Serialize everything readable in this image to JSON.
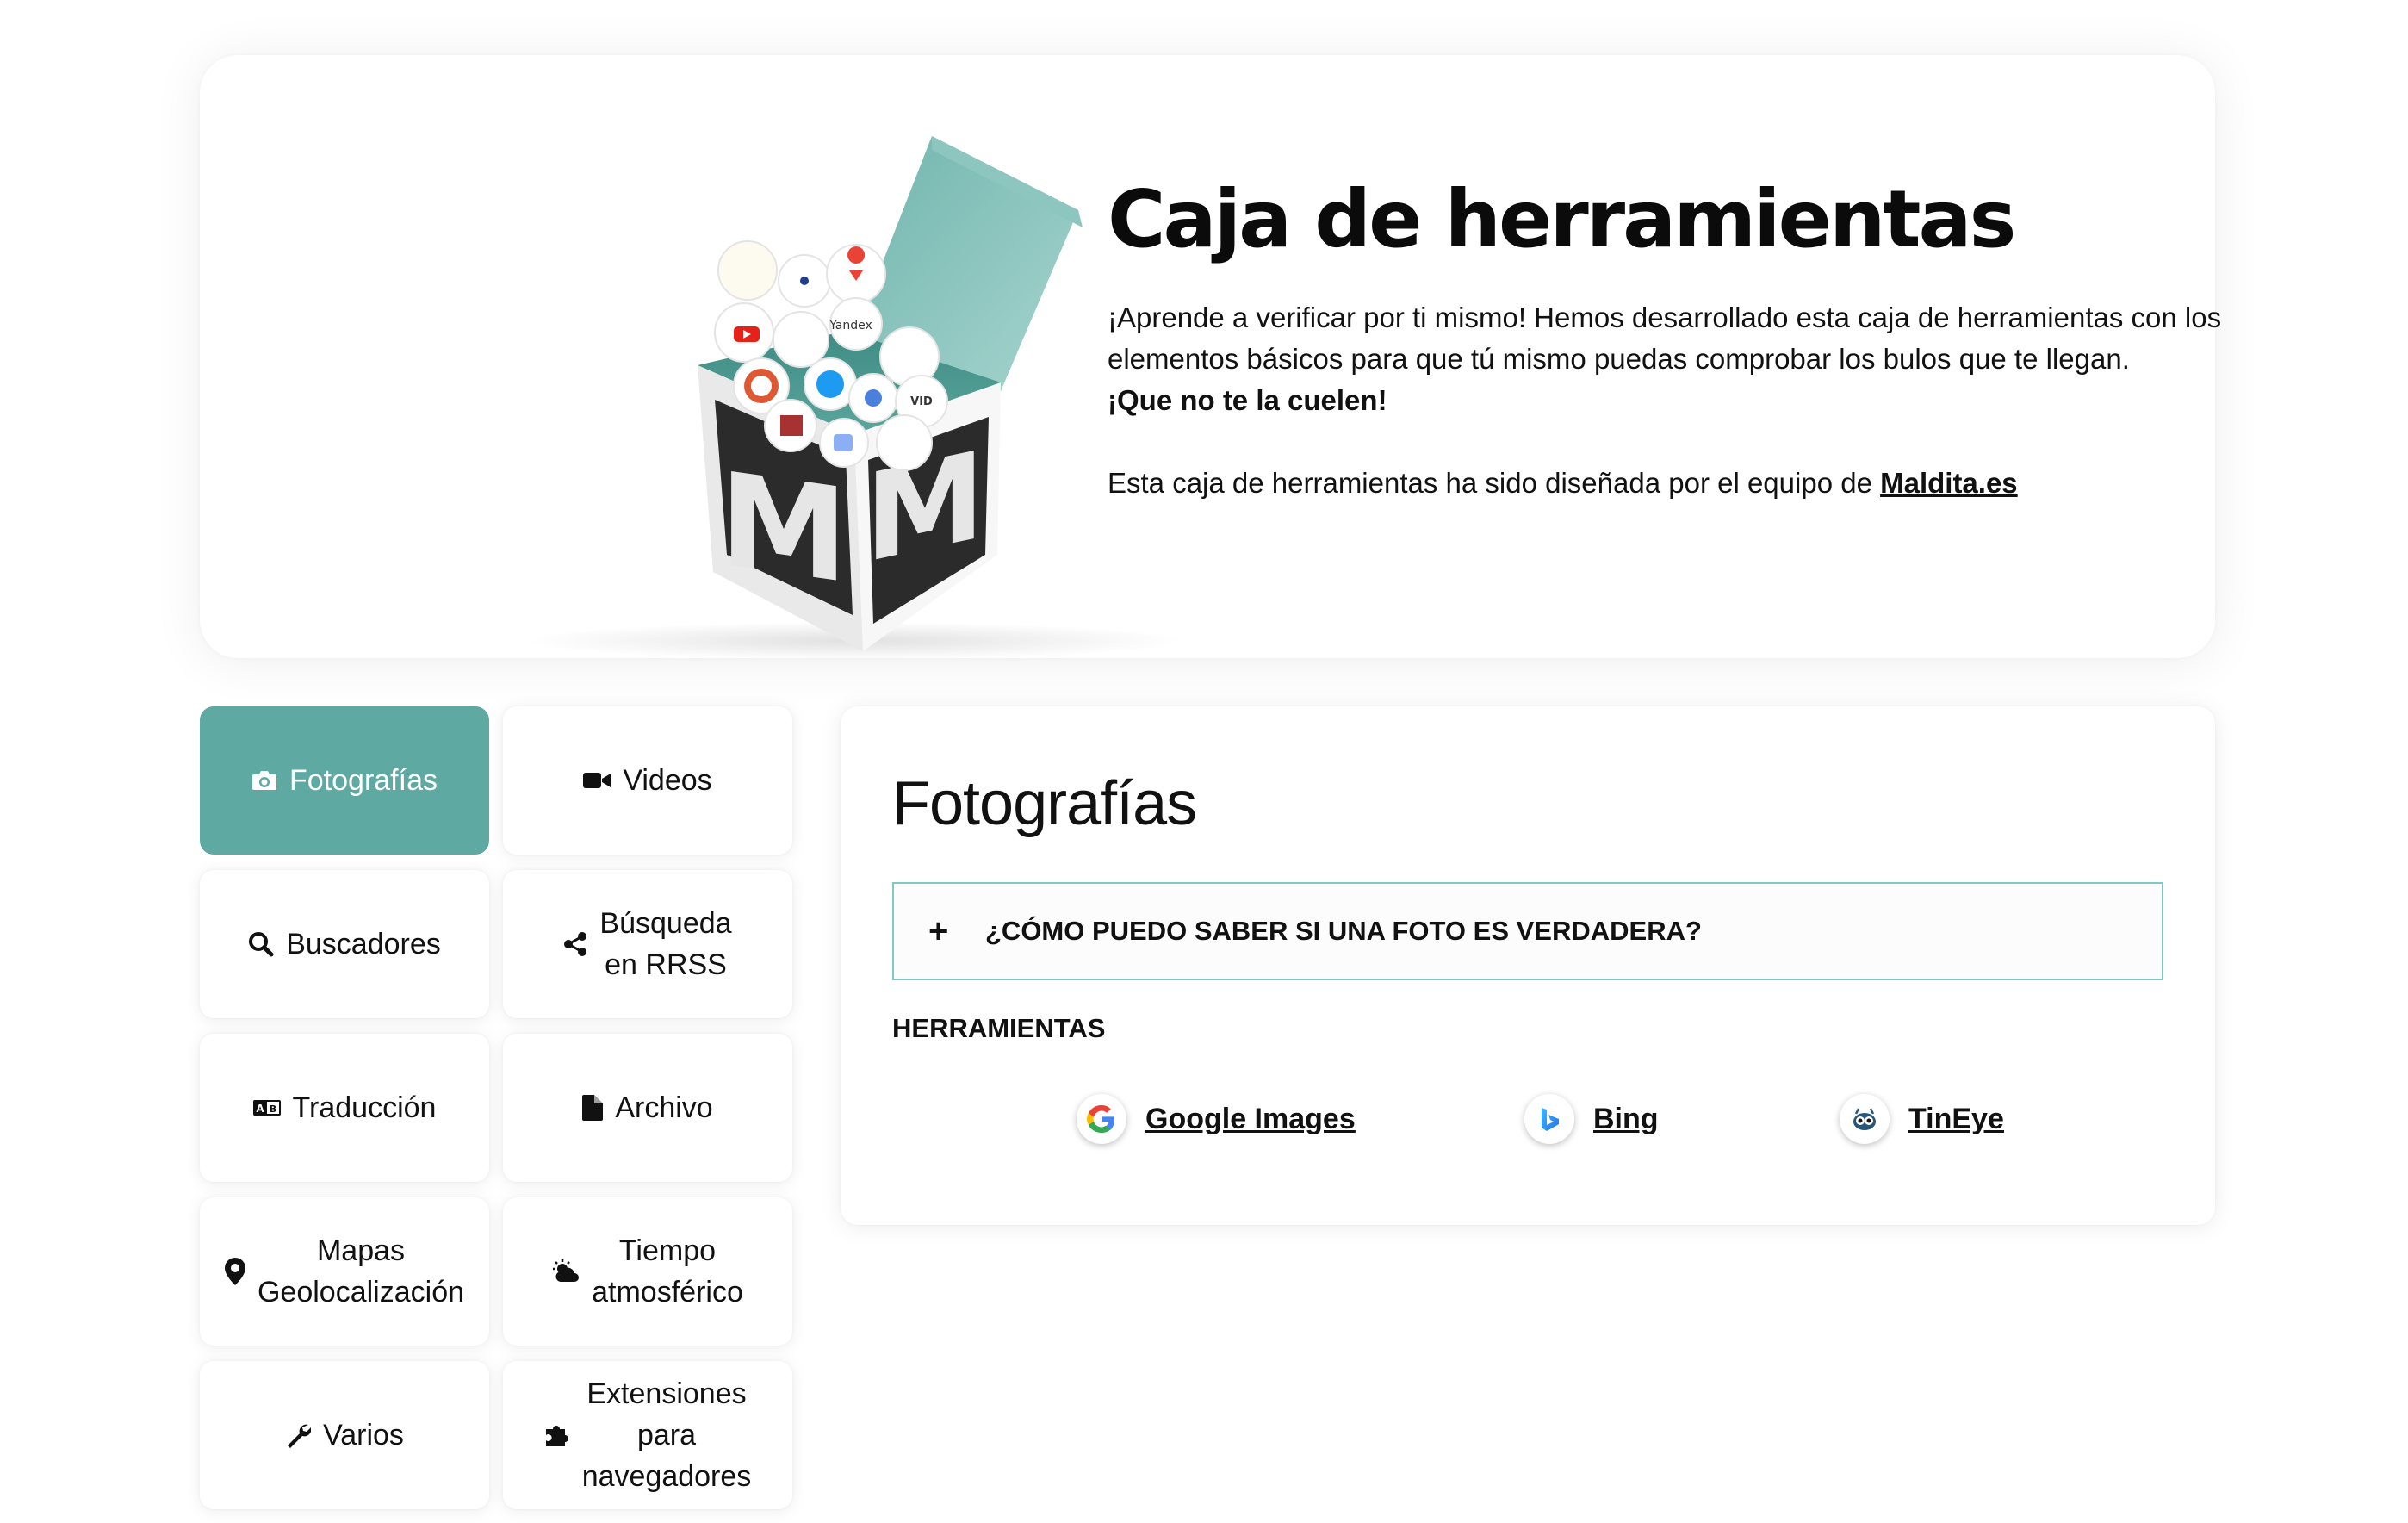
{
  "hero": {
    "title": "Caja de herramientas",
    "desc_main": "¡Aprende a verificar por ti mismo! Hemos desarrollado esta caja de herramientas con los elementos básicos para que tú mismo puedas comprobar los bulos que te llegan.",
    "desc_emphasis": "¡Que no te la cuelen!",
    "credit_prefix": "Esta caja de herramientas ha sido diseñada por el equipo de",
    "credit_link": "Maldita.es",
    "box_letter": "M"
  },
  "tiles": [
    {
      "icon": "camera-icon",
      "label": "Fotografías",
      "active": true
    },
    {
      "icon": "video-camera-icon",
      "label": "Videos",
      "active": false
    },
    {
      "icon": "search-icon",
      "label": "Buscadores",
      "active": false
    },
    {
      "icon": "share-icon",
      "label": "Búsqueda en RRSS",
      "line1": "Búsqueda",
      "line2": "en RRSS",
      "active": false
    },
    {
      "icon": "translate-icon",
      "label": "Traducción",
      "active": false
    },
    {
      "icon": "file-icon",
      "label": "Archivo",
      "active": false
    },
    {
      "icon": "map-pin-icon",
      "label": "Mapas Geolocalización",
      "line1": "Mapas",
      "line2": "Geolocalización",
      "active": false
    },
    {
      "icon": "weather-icon",
      "label": "Tiempo atmosférico",
      "line1": "Tiempo",
      "line2": "atmosférico",
      "active": false
    },
    {
      "icon": "wrench-icon",
      "label": "Varios",
      "active": false
    },
    {
      "icon": "puzzle-icon",
      "label": "Extensiones para navegadores",
      "line1": "Extensiones",
      "line2": "para",
      "line3": "navegadores",
      "active": false
    }
  ],
  "panel": {
    "title": "Fotografías",
    "faq_question": "¿CÓMO PUEDO SABER SI UNA FOTO ES VERDADERA?",
    "faq_toggle": "+",
    "tools_heading": "HERRAMIENTAS",
    "tools": [
      {
        "name": "Google Images",
        "icon": "google-icon"
      },
      {
        "name": "Bing",
        "icon": "bing-icon"
      },
      {
        "name": "TinEye",
        "icon": "tineye-icon"
      }
    ]
  },
  "colors": {
    "accent": "#5ea9a2",
    "faq_border": "#7fcac4",
    "box_teal": "#4f9d94"
  }
}
